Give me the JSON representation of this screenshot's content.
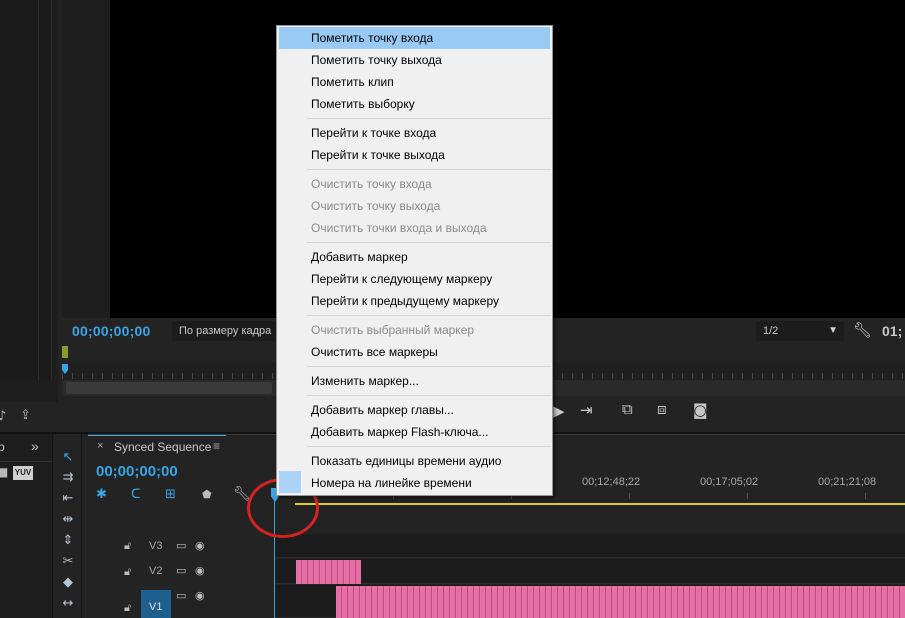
{
  "source_monitor": {
    "timecode": "00;00;00;00",
    "fit_select": "По размеру кадра",
    "resolution_select": "1/2",
    "end_timecode": "01;",
    "wrench_icon": "wrench-icon"
  },
  "timeline": {
    "tab_title": "Synced Sequence",
    "timecode": "00;00;00;00",
    "ruler_labels": [
      "00;12;48;22",
      "00;17;05;02",
      "00;21;21;08"
    ],
    "tracks": [
      {
        "name": "V3"
      },
      {
        "name": "V2"
      },
      {
        "name": "V1"
      }
    ]
  },
  "left_panel": {
    "tab_fragment": "р",
    "expand_glyph": "»",
    "yuv_label": "YUV"
  },
  "context_menu": {
    "items": [
      {
        "label": "Пометить точку входа",
        "highlighted": true,
        "disabled": false
      },
      {
        "label": "Пометить точку выхода",
        "disabled": false
      },
      {
        "label": "Пометить клип",
        "disabled": false
      },
      {
        "label": "Пометить выборку",
        "disabled": false
      },
      {
        "label": "Перейти к точке входа",
        "disabled": false
      },
      {
        "label": "Перейти к точке выхода",
        "disabled": false
      },
      {
        "label": "Очистить точку входа",
        "disabled": true
      },
      {
        "label": "Очистить точку выхода",
        "disabled": true
      },
      {
        "label": "Очистить точки входа и выхода",
        "disabled": true
      },
      {
        "label": "Добавить маркер",
        "disabled": false
      },
      {
        "label": "Перейти к следующему маркеру",
        "disabled": false
      },
      {
        "label": "Перейти к предыдущему маркеру",
        "disabled": false
      },
      {
        "label": "Очистить выбранный маркер",
        "disabled": true
      },
      {
        "label": "Очистить все маркеры",
        "disabled": false
      },
      {
        "label": "Изменить маркер...",
        "disabled": false
      },
      {
        "label": "Добавить маркер главы...",
        "disabled": false
      },
      {
        "label": "Добавить маркер Flash-ключа...",
        "disabled": false
      },
      {
        "label": "Показать единицы времени аудио",
        "disabled": false
      },
      {
        "label": "Номера на линейке времени",
        "checked": true,
        "disabled": false
      }
    ]
  },
  "colors": {
    "accent_blue": "#3aa5e6",
    "clip_pink": "#e76fa6",
    "highlight": "#99c9f5",
    "annotation_red": "#d62222"
  }
}
